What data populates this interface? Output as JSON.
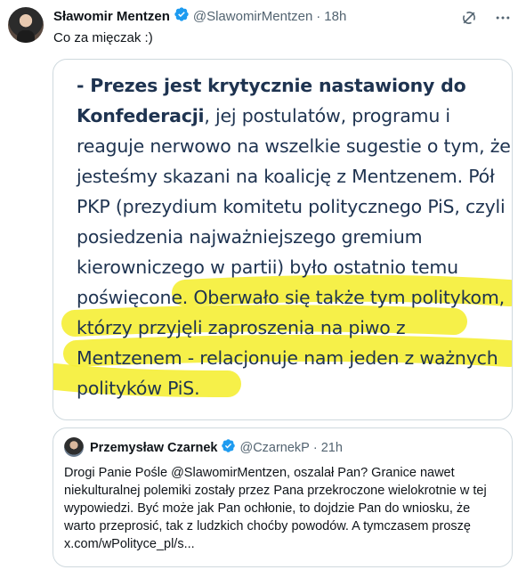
{
  "tweet": {
    "name": "Sławomir Mentzen",
    "handle": "@SlawomirMentzen",
    "dot": "·",
    "time": "18h",
    "text": "Co za mięczak :)",
    "icons": [
      "grok-icon",
      "more-icon"
    ]
  },
  "article": {
    "lines": [
      "- Prezes jest krytycznie nastawiony do",
      "Konfederacji, jej postulatów, programu i",
      "reaguje nerwowo na wszelkie sugestie o tym, że",
      "jesteśmy skazani na koalicję z Mentzenem. Pół",
      "PKP (prezydium komitetu politycznego PiS, czyli",
      "posiedzenia najważniejszego gremium",
      "kierowniczego w partii) było ostatnio temu",
      "poświęcone. Oberwało się także tym politykom,",
      "którzy przyjęli zaproszenia na piwo z",
      "Mentzenem - relacjonuje nam jeden z ważnych",
      "polityków PiS."
    ],
    "highlight_color": "#f5ef3a",
    "text_color": "#1e3350"
  },
  "quote": {
    "name": "Przemysław Czarnek",
    "handle": "@CzarnekP",
    "dot": "·",
    "time": "21h",
    "text": "Drogi Panie Pośle @SlawomirMentzen, oszalał Pan? Granice nawet niekulturalnej polemiki zostały przez Pana przekroczone wielokrotnie w tej wypowiedzi. Być może jak Pan ochłonie, to dojdzie Pan do wniosku, że warto przeprosić, tak z ludzkich choćby powodów. A tymczasem proszę x.com/wPolityce_pl/s..."
  },
  "colors": {
    "verified": "#1d9bf0",
    "secondary_text": "#536471",
    "border": "#cfd9de"
  }
}
